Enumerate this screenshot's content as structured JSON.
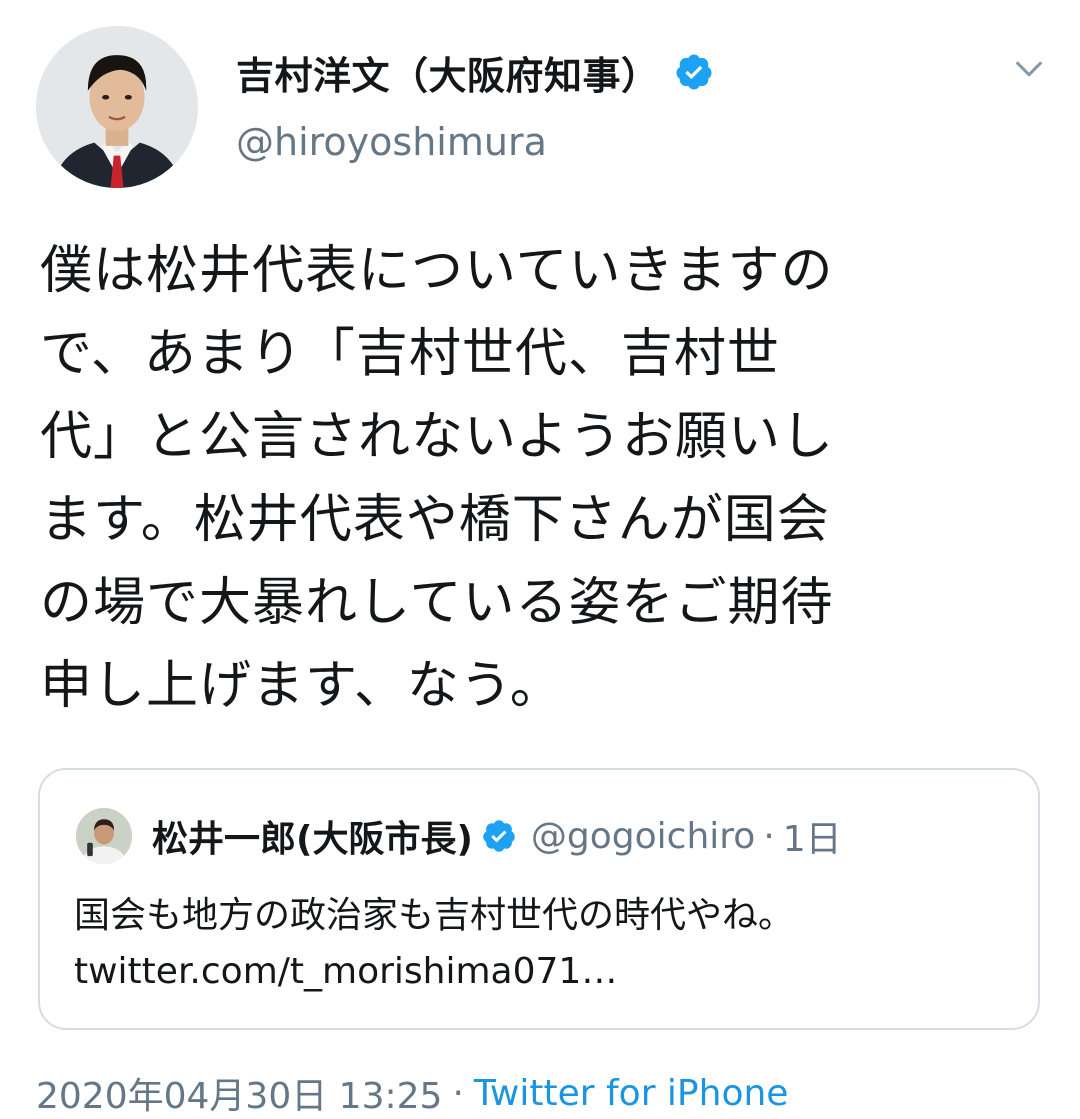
{
  "author": {
    "display_name": "吉村洋文（大阪府知事）",
    "handle": "@hiroyoshimura",
    "verified": true
  },
  "tweet": {
    "lines": [
      "僕は松井代表についていきますの",
      "で、あまり「吉村世代、吉村世",
      "代」と公言されないようお願いし",
      "ます。松井代表や橋下さんが国会",
      "の場で大暴れしている姿をご期待",
      "申し上げます、なう。"
    ]
  },
  "quote": {
    "display_name": "松井一郎(大阪市長)",
    "handle": "@gogoichiro",
    "separator": "·",
    "time": "1日",
    "verified": true,
    "lines": [
      "国会も地方の政治家も吉村世代の時代やね。",
      "twitter.com/t_morishima071…"
    ]
  },
  "footer": {
    "timestamp": "2020年04月30日 13:25",
    "separator": "·",
    "source": "Twitter for iPhone"
  },
  "icons": {
    "verified": "verified-badge-icon",
    "menu": "chevron-down-icon"
  },
  "colors": {
    "text_primary": "#14171a",
    "text_secondary": "#657786",
    "link": "#1b95e0",
    "verified": "#1da1f2",
    "border": "#d5dde3"
  }
}
